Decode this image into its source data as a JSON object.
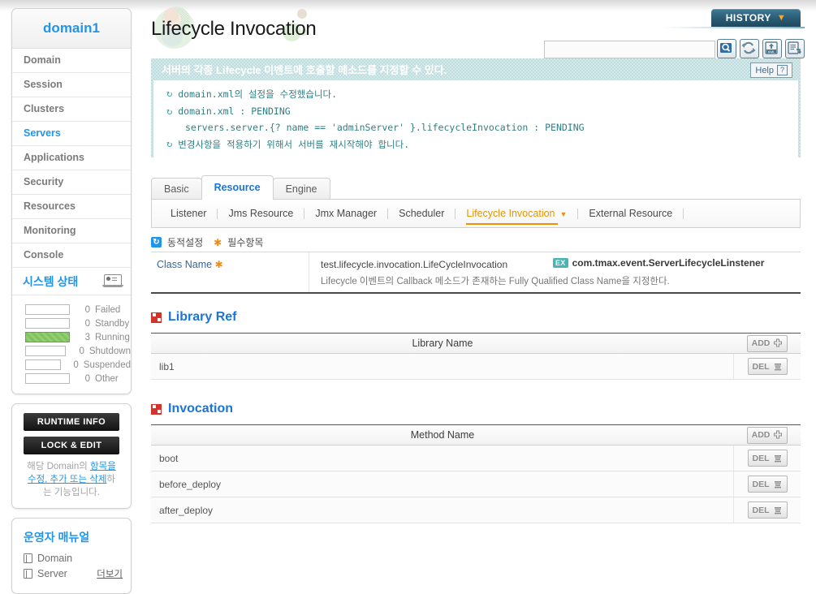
{
  "sidebar": {
    "domain_title": "domain1",
    "nav_items": [
      {
        "label": "Domain",
        "active": false
      },
      {
        "label": "Session",
        "active": false
      },
      {
        "label": "Clusters",
        "active": false
      },
      {
        "label": "Servers",
        "active": true
      },
      {
        "label": "Applications",
        "active": false
      },
      {
        "label": "Security",
        "active": false
      },
      {
        "label": "Resources",
        "active": false
      },
      {
        "label": "Monitoring",
        "active": false
      },
      {
        "label": "Console",
        "active": false
      }
    ],
    "system_status": {
      "title": "시스템 상태",
      "icon": "monitor-icon",
      "rows": [
        {
          "count": "0",
          "label": "Failed",
          "filled": false
        },
        {
          "count": "0",
          "label": "Standby",
          "filled": false
        },
        {
          "count": "3",
          "label": "Running",
          "filled": true
        },
        {
          "count": "0",
          "label": "Shutdown",
          "filled": false
        },
        {
          "count": "0",
          "label": "Suspended",
          "filled": false
        },
        {
          "count": "0",
          "label": "Other",
          "filled": false
        }
      ]
    },
    "runtime_info_label": "RUNTIME INFO",
    "lock_edit_label": "LOCK & EDIT",
    "lock_desc_1": "해당 Domain의 ",
    "lock_desc_link": "항목을 수정, 추가 또는 삭제",
    "lock_desc_2": "하는 기능입니다.",
    "manual_title": "운영자 매뉴얼",
    "manual_items": [
      {
        "label": "Domain"
      },
      {
        "label": "Server"
      }
    ],
    "more_label": "더보기"
  },
  "header": {
    "page_title": "Lifecycle Invocation",
    "history_label": "HISTORY",
    "history_caret": "▼",
    "search_placeholder": "",
    "search_value": "",
    "toolbar_icons": [
      "search-icon",
      "refresh-icon",
      "xml-export-icon",
      "report-export-icon"
    ]
  },
  "message_box": {
    "heading": "서버의 각종 Lifecycle 이벤트에 호출할 메소드를 지정할 수 있다.",
    "help_label": "Help",
    "lines": [
      {
        "text": "domain.xml의 설정을 수정했습니다.",
        "bullet": true,
        "sub": false
      },
      {
        "text": "domain.xml : PENDING",
        "bullet": true,
        "sub": false
      },
      {
        "text": "servers.server.{? name == 'adminServer' }.lifecycleInvocation : PENDING",
        "bullet": false,
        "sub": true
      },
      {
        "text": "변경사항을 적용하기 위해서 서버를 재시작해야 합니다.",
        "bullet": true,
        "sub": false
      }
    ]
  },
  "tabs": [
    {
      "label": "Basic",
      "active": false
    },
    {
      "label": "Resource",
      "active": true
    },
    {
      "label": "Engine",
      "active": false
    }
  ],
  "subnav": [
    {
      "label": "Listener",
      "active": false,
      "caret": false
    },
    {
      "label": "Jms Resource",
      "active": false,
      "caret": false
    },
    {
      "label": "Jmx Manager",
      "active": false,
      "caret": false
    },
    {
      "label": "Scheduler",
      "active": false,
      "caret": false
    },
    {
      "label": "Lifecycle Invocation",
      "active": true,
      "caret": true
    },
    {
      "label": "External Resource",
      "active": false,
      "caret": false
    }
  ],
  "legend": {
    "dynamic_label": "동적설정",
    "required_label": "필수항목"
  },
  "field": {
    "label": "Class Name",
    "value": "test.lifecycle.invocation.LifeCycleInvocation",
    "example_badge": "EX",
    "example_value": "com.tmax.event.ServerLifecycleLinstener",
    "description": "Lifecycle 이벤트의 Callback 메소드가 존재하는 Fully Qualified Class Name을 지정한다."
  },
  "library_ref": {
    "title": "Library Ref",
    "column_header": "Library Name",
    "add_label": "ADD",
    "del_label": "DEL",
    "rows": [
      {
        "name": "lib1"
      }
    ]
  },
  "invocation": {
    "title": "Invocation",
    "column_header": "Method Name",
    "add_label": "ADD",
    "del_label": "DEL",
    "rows": [
      {
        "name": "boot"
      },
      {
        "name": "before_deploy"
      },
      {
        "name": "after_deploy"
      }
    ]
  },
  "colors": {
    "accent_blue": "#2196e8",
    "tab_blue": "#1c74d4",
    "orange": "#e79400",
    "teal": "#49b3b8",
    "red": "#d0342c",
    "green": "#7fc35c"
  }
}
